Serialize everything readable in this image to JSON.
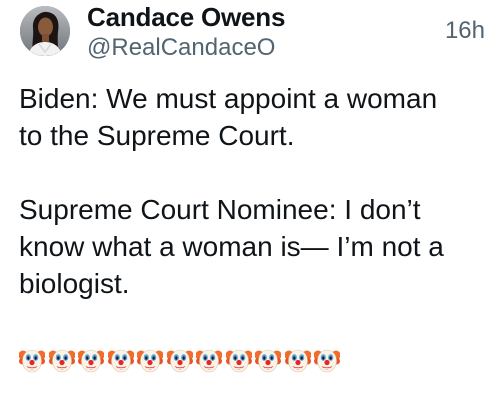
{
  "author": {
    "display_name": "Candace Owens",
    "handle": "@RealCandaceO",
    "avatar_icon": "profile-photo"
  },
  "timestamp": "16h",
  "tweet": {
    "paragraphs": [
      [
        "Biden: We must appoint a woman",
        "to the Supreme Court."
      ],
      [
        "Supreme Court Nominee: I don’t",
        "know what a woman is— I’m not a",
        "biologist."
      ]
    ],
    "emoji": {
      "name": "clown-face",
      "glyph": "🤡",
      "count": 11
    }
  },
  "colors": {
    "text": "#0f1419",
    "secondary": "#536471"
  }
}
